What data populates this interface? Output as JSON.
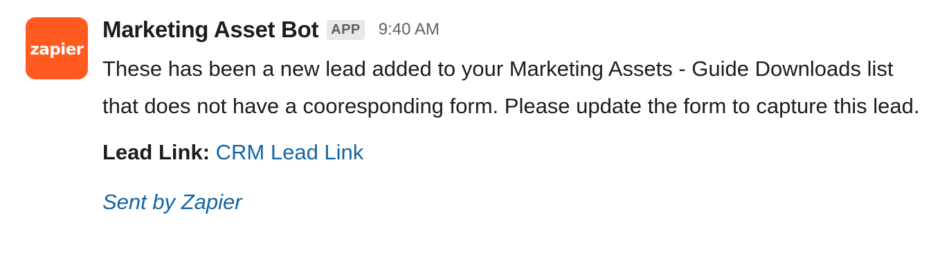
{
  "avatar": {
    "logo_text": "zapier",
    "color": "#ff5a1f"
  },
  "message": {
    "sender": "Marketing Asset Bot",
    "badge": "APP",
    "time": "9:40 AM",
    "body": "These has been a new lead added to your Marketing Assets - Guide Downloads list that does not have a cooresponding form. Please update the form to capture this lead.",
    "lead_label": "Lead Link:",
    "lead_link_text": "CRM Lead Link",
    "footer": "Sent by Zapier"
  },
  "colors": {
    "link": "#1264a3",
    "text": "#1d1c1d",
    "muted": "#616061"
  }
}
